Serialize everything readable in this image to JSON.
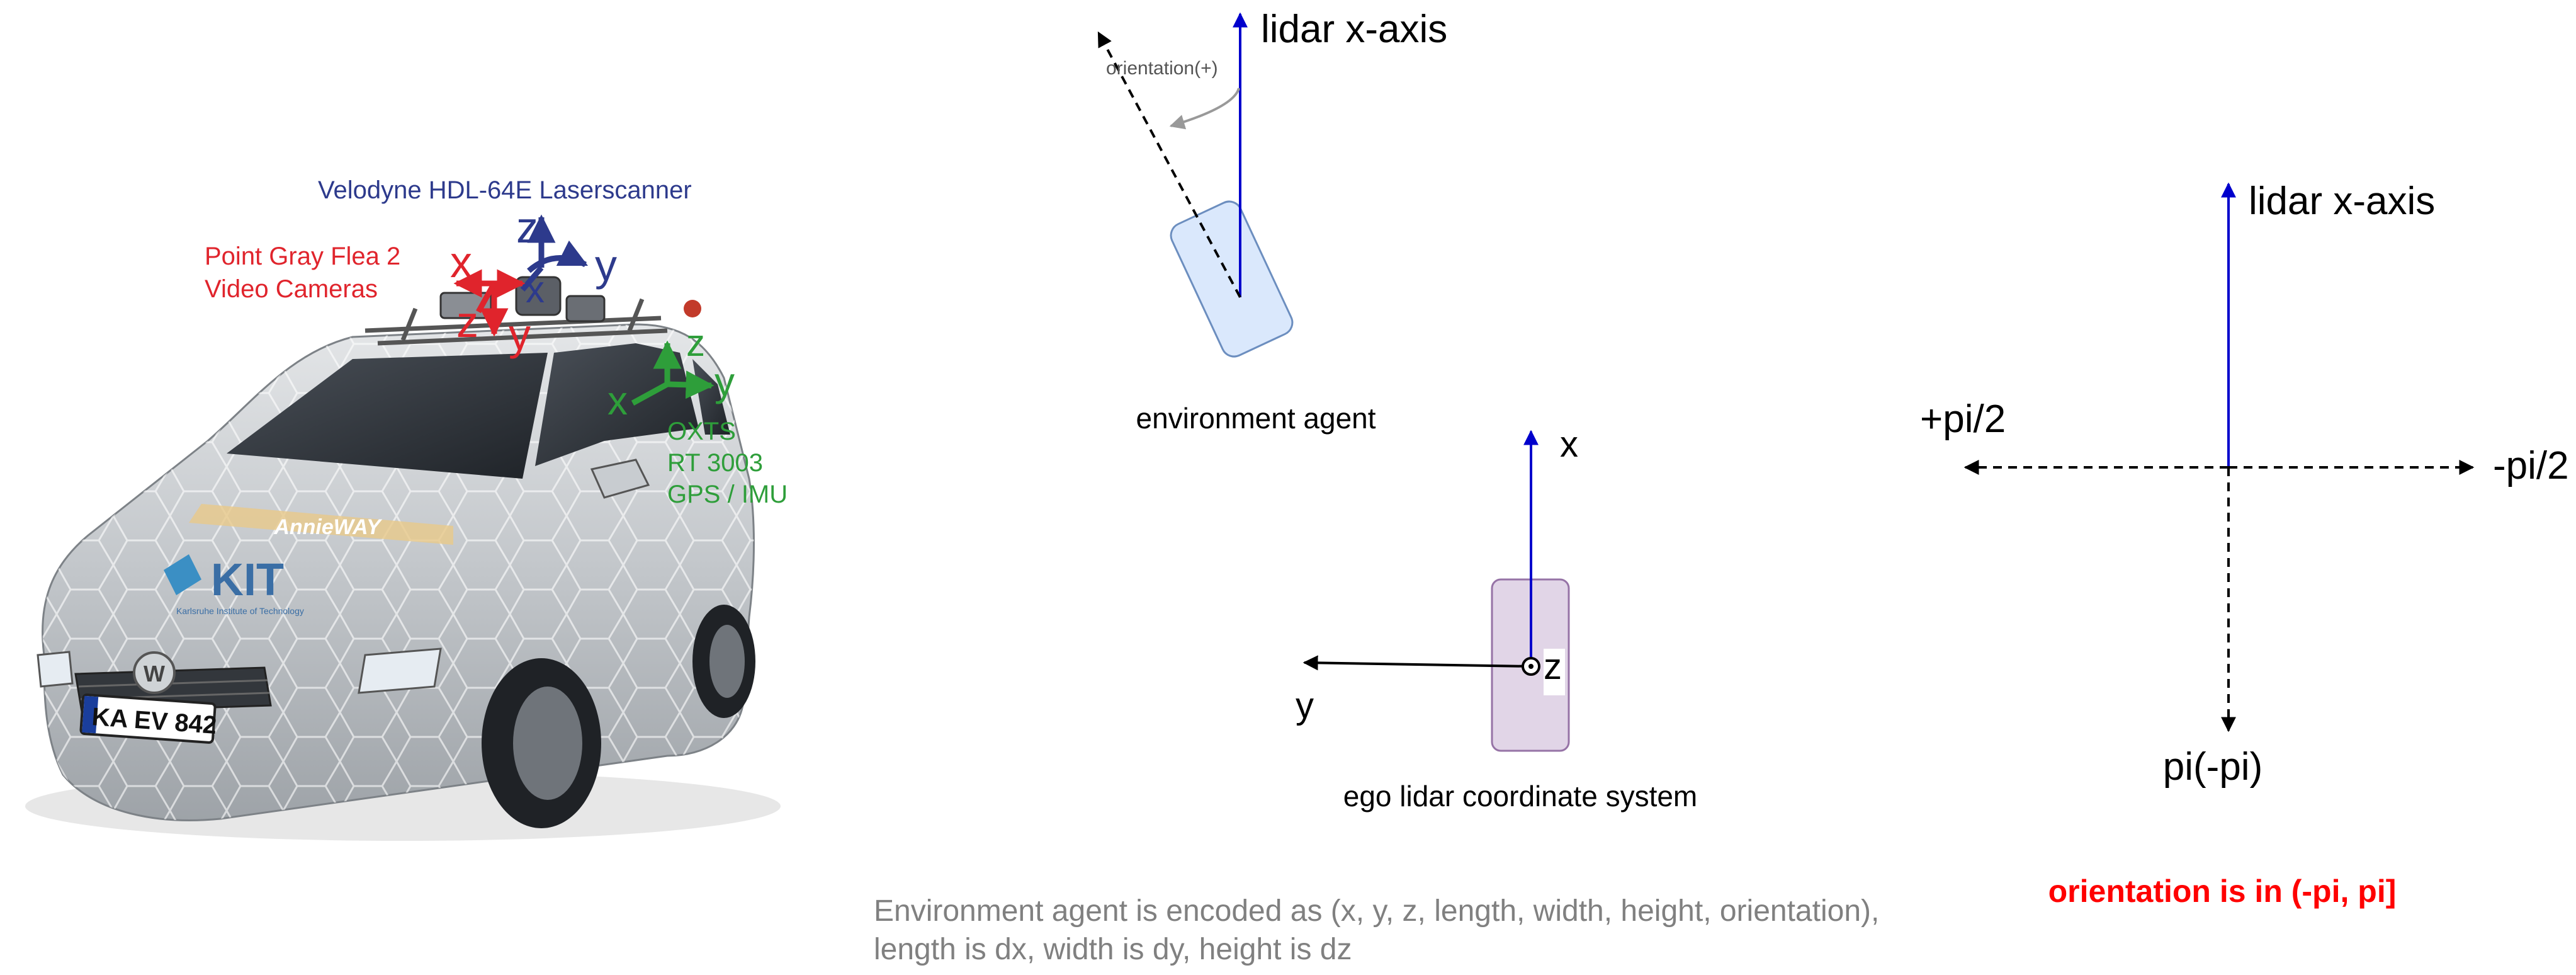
{
  "car_panel": {
    "lidar_label": "Velodyne HDL-64E Laserscanner",
    "camera_label_line1": "Point Gray Flea 2",
    "camera_label_line2": "Video Cameras",
    "gps_label_line1": "OXTS",
    "gps_label_line2": "RT 3003",
    "gps_label_line3": "GPS / IMU",
    "lidar_axes": {
      "x": "x",
      "y": "y",
      "z": "z"
    },
    "camera_axes": {
      "x": "x",
      "y": "y",
      "z": "z"
    },
    "gps_axes": {
      "x": "x",
      "y": "y",
      "z": "z"
    },
    "car_brand": "AnnieWAY",
    "kit_logo": "KIT",
    "kit_subtitle": "Karlsruhe Institute of Technology",
    "license_plate": "KA EV 842",
    "colors": {
      "lidar": "#2d3a8c",
      "camera": "#e0242c",
      "gps": "#2e9e3a"
    }
  },
  "agent_panel": {
    "axis_label": "lidar x-axis",
    "orientation_label": "orientation(+)",
    "agent_label": "environment agent",
    "agent_box_color": "#dae8fc",
    "agent_box_border": "#6c8ebf",
    "axis_color": "#0000cc"
  },
  "ego_panel": {
    "x_label": "x",
    "y_label": "y",
    "z_label": "z",
    "caption": "ego lidar coordinate system",
    "ego_box_color": "#e1d5e7",
    "ego_box_border": "#9673a6"
  },
  "orientation_panel": {
    "axis_label": "lidar x-axis",
    "left_label": "+pi/2",
    "right_label": "-pi/2",
    "bottom_label": "pi(-pi)",
    "range_note": "orientation is in (-pi, pi]",
    "range_note_color": "#ff0000"
  },
  "footnote": {
    "line1": "Environment agent is encoded as (x, y, z, length, width, height, orientation),",
    "line2": "length is dx, width is dy, height is dz",
    "color": "#808080"
  }
}
